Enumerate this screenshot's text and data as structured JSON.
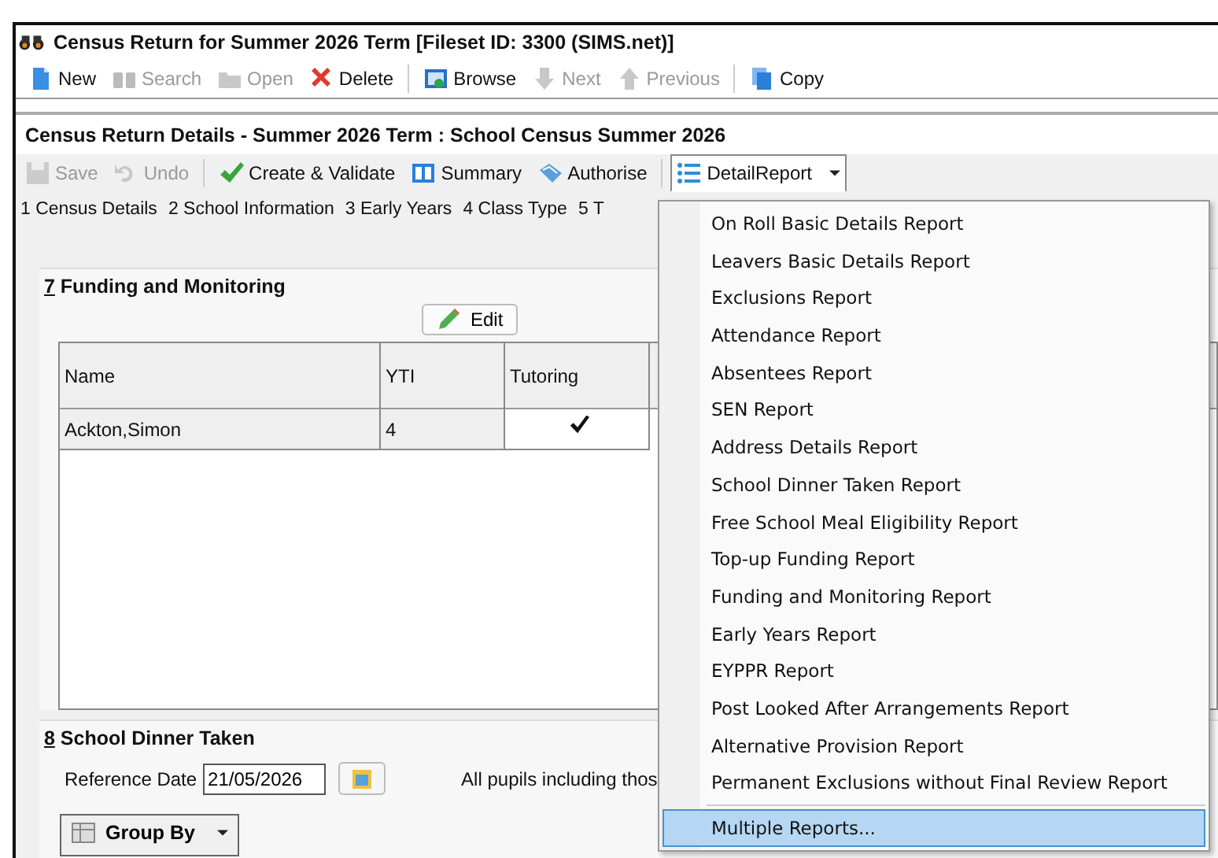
{
  "window": {
    "title": "Census Return for Summer 2026 Term [Fileset ID:  3300 (SIMS.net)]"
  },
  "toolbar": [
    {
      "label": "New",
      "disabled": false
    },
    {
      "label": "Search",
      "disabled": true
    },
    {
      "label": "Open",
      "disabled": true
    },
    {
      "label": "Delete",
      "disabled": false
    },
    {
      "label": "Browse",
      "disabled": false
    },
    {
      "label": "Next",
      "disabled": true
    },
    {
      "label": "Previous",
      "disabled": true
    },
    {
      "label": "Copy",
      "disabled": false
    }
  ],
  "panel": {
    "title": "Census Return Details - Summer 2026 Term : School Census Summer 2026",
    "toolbar": [
      {
        "label": "Save",
        "disabled": true
      },
      {
        "label": "Undo",
        "disabled": true
      },
      {
        "label": "Create & Validate",
        "disabled": false
      },
      {
        "label": "Summary",
        "disabled": false
      },
      {
        "label": "Authorise",
        "disabled": false
      }
    ],
    "report_button": {
      "label": "DetailReport",
      "expanded": true
    },
    "tabs": [
      "1 Census Details",
      "2 School Information",
      "3 Early Years",
      "4 Class Type",
      "5 T"
    ]
  },
  "funding": {
    "number": "7",
    "title": "Funding and Monitoring",
    "edit_button": "Edit",
    "columns": [
      "Name",
      "YTI",
      "Tutoring"
    ],
    "rows": [
      {
        "name": "Ackton,Simon",
        "yti": "4",
        "tutoring": true
      }
    ]
  },
  "dinner": {
    "number": "8",
    "title": "School Dinner Taken",
    "date_label": "Reference Date",
    "date": "21/05/2026",
    "note": "All pupils including thos",
    "group_by": "Group By"
  },
  "menu": [
    {
      "label": "On Roll Basic Details Report",
      "selected": false
    },
    {
      "label": "Leavers Basic Details Report",
      "selected": false
    },
    {
      "label": "Exclusions Report",
      "selected": false
    },
    {
      "label": "Attendance Report",
      "selected": false
    },
    {
      "label": "Absentees Report",
      "selected": false
    },
    {
      "label": "SEN Report",
      "selected": false
    },
    {
      "label": "Address Details Report",
      "selected": false
    },
    {
      "label": "School Dinner Taken Report",
      "selected": false
    },
    {
      "label": "Free School Meal Eligibility Report",
      "selected": false
    },
    {
      "label": "Top-up Funding Report",
      "selected": false
    },
    {
      "label": "Funding and Monitoring Report",
      "selected": false
    },
    {
      "label": "Early Years Report",
      "selected": false
    },
    {
      "label": "EYPPR Report",
      "selected": false
    },
    {
      "label": "Post Looked After Arrangements Report",
      "selected": false
    },
    {
      "label": "Alternative Provision Report",
      "selected": false
    },
    {
      "label": "Permanent Exclusions without Final Review Report",
      "selected": false
    },
    {
      "label": "Multiple Reports...",
      "selected": true
    }
  ]
}
